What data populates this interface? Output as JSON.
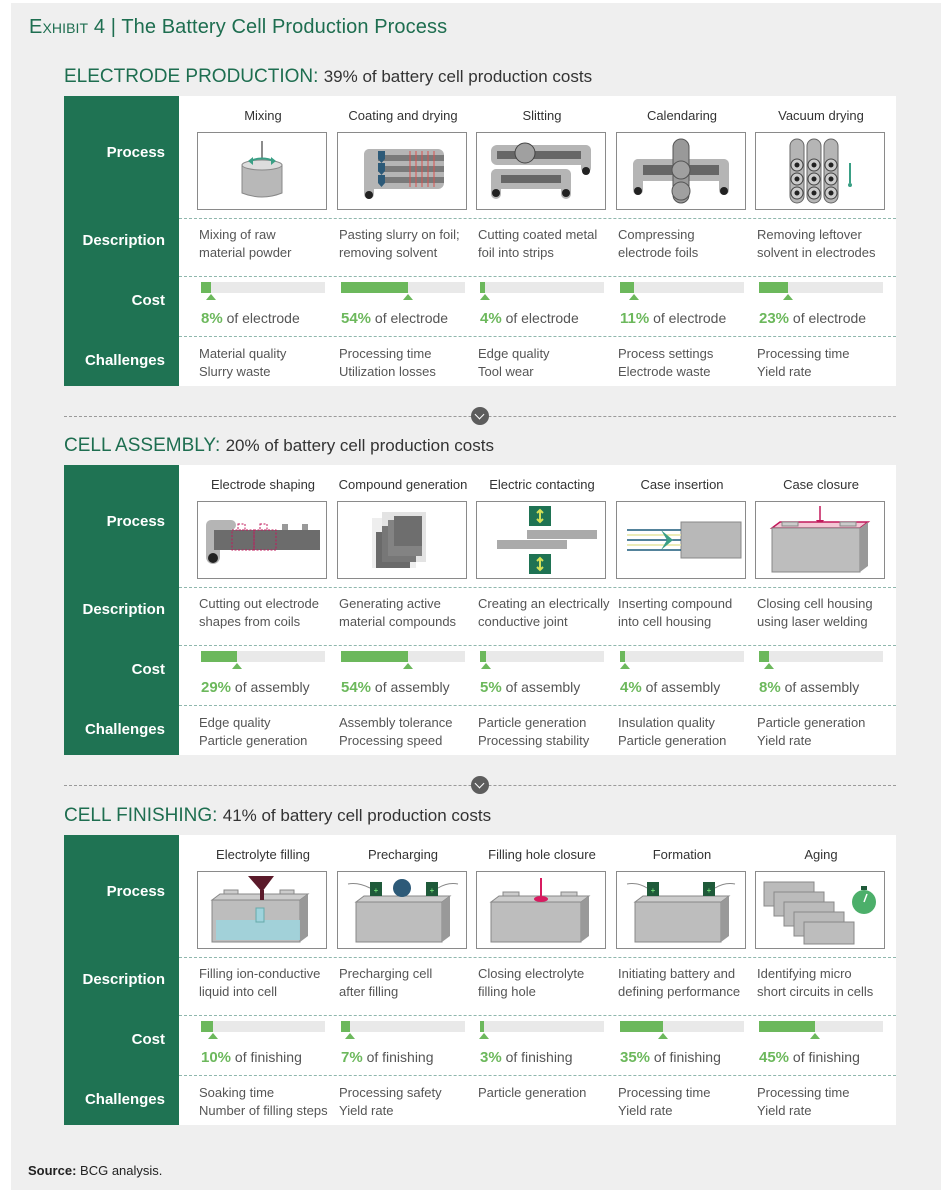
{
  "exhibit": {
    "label": "Exhibit 4",
    "divider": "|",
    "title": "The Battery Cell Production Process"
  },
  "row_labels": {
    "process": "Process",
    "description": "Description",
    "cost": "Cost",
    "challenges": "Challenges"
  },
  "colors": {
    "brand_green": "#1f7353",
    "title_green": "#1e6e50",
    "cost_green": "#6cb85c",
    "panel_bg": "#efefef"
  },
  "sections": [
    {
      "title": "ELECTRODE PRODUCTION:",
      "subtitle": "39% of battery cell production costs",
      "share_percent": 39,
      "steps": [
        {
          "name": "Mixing",
          "icon": "mixing-icon",
          "desc1": "Mixing of raw",
          "desc2": "material powder",
          "cost_pct": 8,
          "cost_label": "8%",
          "cost_suffix": "of electrode",
          "chal1": "Material quality",
          "chal2": "Slurry waste"
        },
        {
          "name": "Coating and drying",
          "icon": "coating-icon",
          "desc1": "Pasting slurry on foil;",
          "desc2": "removing solvent",
          "cost_pct": 54,
          "cost_label": "54%",
          "cost_suffix": "of electrode",
          "chal1": "Processing time",
          "chal2": "Utilization losses"
        },
        {
          "name": "Slitting",
          "icon": "slitting-icon",
          "desc1": "Cutting coated metal",
          "desc2": "foil into strips",
          "cost_pct": 4,
          "cost_label": "4%",
          "cost_suffix": "of electrode",
          "chal1": "Edge quality",
          "chal2": "Tool wear"
        },
        {
          "name": "Calendaring",
          "icon": "calendaring-icon",
          "desc1": "Compressing",
          "desc2": "electrode foils",
          "cost_pct": 11,
          "cost_label": "11%",
          "cost_suffix": "of electrode",
          "chal1": "Process settings",
          "chal2": "Electrode waste"
        },
        {
          "name": "Vacuum drying",
          "icon": "vacuum-drying-icon",
          "desc1": "Removing leftover",
          "desc2": "solvent in electrodes",
          "cost_pct": 23,
          "cost_label": "23%",
          "cost_suffix": "of electrode",
          "chal1": "Processing time",
          "chal2": "Yield rate"
        }
      ]
    },
    {
      "title": "CELL ASSEMBLY:",
      "subtitle": "20% of battery cell production costs",
      "share_percent": 20,
      "steps": [
        {
          "name": "Electrode shaping",
          "icon": "electrode-shaping-icon",
          "desc1": "Cutting out electrode",
          "desc2": "shapes from coils",
          "cost_pct": 29,
          "cost_label": "29%",
          "cost_suffix": "of assembly",
          "chal1": "Edge quality",
          "chal2": "Particle generation"
        },
        {
          "name": "Compound generation",
          "icon": "compound-generation-icon",
          "desc1": "Generating active",
          "desc2": "material compounds",
          "cost_pct": 54,
          "cost_label": "54%",
          "cost_suffix": "of assembly",
          "chal1": "Assembly tolerance",
          "chal2": "Processing speed"
        },
        {
          "name": "Electric contacting",
          "icon": "electric-contacting-icon",
          "desc1": "Creating an electrically",
          "desc2": "conductive joint",
          "cost_pct": 5,
          "cost_label": "5%",
          "cost_suffix": "of assembly",
          "chal1": "Particle generation",
          "chal2": "Processing stability"
        },
        {
          "name": "Case insertion",
          "icon": "case-insertion-icon",
          "desc1": "Inserting compound",
          "desc2": "into cell housing",
          "cost_pct": 4,
          "cost_label": "4%",
          "cost_suffix": "of assembly",
          "chal1": "Insulation quality",
          "chal2": "Particle generation"
        },
        {
          "name": "Case closure",
          "icon": "case-closure-icon",
          "desc1": "Closing cell housing",
          "desc2": "using laser welding",
          "cost_pct": 8,
          "cost_label": "8%",
          "cost_suffix": "of assembly",
          "chal1": "Particle generation",
          "chal2": "Yield rate"
        }
      ]
    },
    {
      "title": "CELL FINISHING:",
      "subtitle": "41% of battery cell production costs",
      "share_percent": 41,
      "steps": [
        {
          "name": "Electrolyte filling",
          "icon": "electrolyte-filling-icon",
          "desc1": "Filling ion-conductive",
          "desc2": "liquid into cell",
          "cost_pct": 10,
          "cost_label": "10%",
          "cost_suffix": "of finishing",
          "chal1": "Soaking time",
          "chal2": "Number of filling steps"
        },
        {
          "name": "Precharging",
          "icon": "precharging-icon",
          "desc1": "Precharging cell",
          "desc2": "after filling",
          "cost_pct": 7,
          "cost_label": "7%",
          "cost_suffix": "of finishing",
          "chal1": "Processing safety",
          "chal2": "Yield rate"
        },
        {
          "name": "Filling hole closure",
          "icon": "filling-hole-closure-icon",
          "desc1": "Closing electrolyte",
          "desc2": "filling hole",
          "cost_pct": 3,
          "cost_label": "3%",
          "cost_suffix": "of finishing",
          "chal1": "Particle generation",
          "chal2": ""
        },
        {
          "name": "Formation",
          "icon": "formation-icon",
          "desc1": "Initiating battery and",
          "desc2": "defining performance",
          "cost_pct": 35,
          "cost_label": "35%",
          "cost_suffix": "of finishing",
          "chal1": "Processing time",
          "chal2": "Yield rate"
        },
        {
          "name": "Aging",
          "icon": "aging-icon",
          "desc1": "Identifying micro",
          "desc2": "short circuits in cells",
          "cost_pct": 45,
          "cost_label": "45%",
          "cost_suffix": "of finishing",
          "chal1": "Processing time",
          "chal2": "Yield rate"
        }
      ]
    }
  ],
  "source": {
    "label": "Source:",
    "text": "BCG analysis."
  }
}
